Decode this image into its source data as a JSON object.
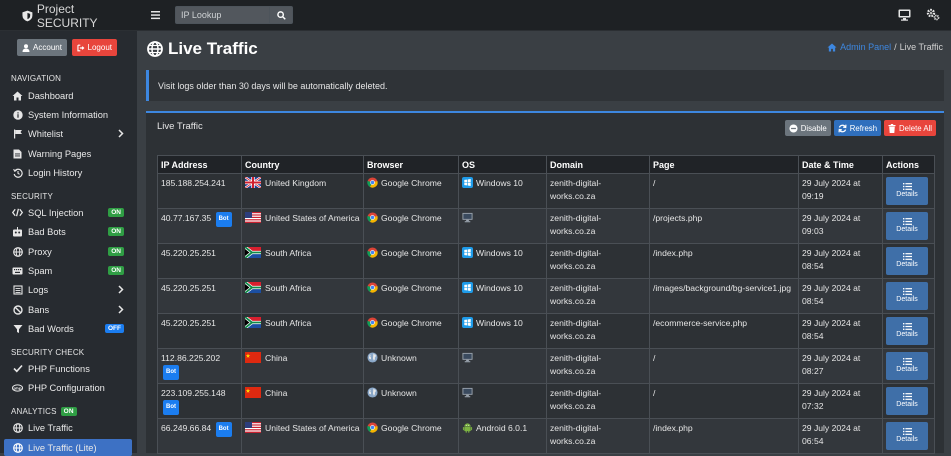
{
  "app": {
    "brand": "Project SECURITY"
  },
  "search": {
    "placeholder": "IP Lookup"
  },
  "account": {
    "account_label": "Account",
    "logout_label": "Logout"
  },
  "sidebar": {
    "navigation_heading": "NAVIGATION",
    "security_heading": "SECURITY",
    "security_check_heading": "SECURITY CHECK",
    "analytics_heading": "ANALYTICS",
    "analytics_badge": "ON",
    "items": {
      "dashboard": "Dashboard",
      "system_info": "System Information",
      "whitelist": "Whitelist",
      "warning_pages": "Warning Pages",
      "login_history": "Login History",
      "sql_injection": "SQL Injection",
      "bad_bots": "Bad Bots",
      "proxy": "Proxy",
      "spam": "Spam",
      "logs": "Logs",
      "bans": "Bans",
      "bad_words": "Bad Words",
      "php_functions": "PHP Functions",
      "php_configuration": "PHP Configuration",
      "live_traffic": "Live Traffic",
      "live_traffic_lite": "Live Traffic (Lite)"
    },
    "badges": {
      "sql_injection": "ON",
      "bad_bots": "ON",
      "proxy": "ON",
      "spam": "ON",
      "bad_words": "OFF"
    }
  },
  "page": {
    "title": "Live Traffic",
    "breadcrumb_home": "Admin Panel",
    "breadcrumb_sep": "/",
    "breadcrumb_current": "Live Traffic",
    "alert": "Visit logs older than 30 days will be automatically deleted."
  },
  "card": {
    "title": "Live Traffic",
    "disable_label": "Disable",
    "refresh_label": "Refresh",
    "delete_label": "Delete All"
  },
  "table": {
    "headers": [
      "IP Address",
      "Country",
      "Browser",
      "OS",
      "Domain",
      "Page",
      "Date & Time",
      "Actions"
    ],
    "details_label": "Details",
    "bot_label": "Bot",
    "rows": [
      {
        "ip": "185.188.254.241",
        "bot": false,
        "country": "United Kingdom",
        "flag": "uk",
        "browser": "Google Chrome",
        "browser_icon": "chrome",
        "os": "Windows 10",
        "os_icon": "windows",
        "domain": "zenith-digital-works.co.za",
        "page": "/",
        "datetime": "29 July 2024 at 09:19"
      },
      {
        "ip": "40.77.167.35",
        "bot": true,
        "country": "United States of America",
        "flag": "us",
        "browser": "Google Chrome",
        "browser_icon": "chrome",
        "os": "",
        "os_icon": "monitor",
        "domain": "zenith-digital-works.co.za",
        "page": "/projects.php",
        "datetime": "29 July 2024 at 09:03"
      },
      {
        "ip": "45.220.25.251",
        "bot": false,
        "country": "South Africa",
        "flag": "za",
        "browser": "Google Chrome",
        "browser_icon": "chrome",
        "os": "Windows 10",
        "os_icon": "windows",
        "domain": "zenith-digital-works.co.za",
        "page": "/index.php",
        "datetime": "29 July 2024 at 08:54"
      },
      {
        "ip": "45.220.25.251",
        "bot": false,
        "country": "South Africa",
        "flag": "za",
        "browser": "Google Chrome",
        "browser_icon": "chrome",
        "os": "Windows 10",
        "os_icon": "windows",
        "domain": "zenith-digital-works.co.za",
        "page": "/images/background/bg-service1.jpg",
        "datetime": "29 July 2024 at 08:54"
      },
      {
        "ip": "45.220.25.251",
        "bot": false,
        "country": "South Africa",
        "flag": "za",
        "browser": "Google Chrome",
        "browser_icon": "chrome",
        "os": "Windows 10",
        "os_icon": "windows",
        "domain": "zenith-digital-works.co.za",
        "page": "/ecommerce-service.php",
        "datetime": "29 July 2024 at 08:54"
      },
      {
        "ip": "112.86.225.202",
        "bot": true,
        "country": "China",
        "flag": "cn",
        "browser": "Unknown",
        "browser_icon": "globe",
        "os": "",
        "os_icon": "monitor",
        "domain": "zenith-digital-works.co.za",
        "page": "/",
        "datetime": "29 July 2024 at 08:27"
      },
      {
        "ip": "223.109.255.148",
        "bot": true,
        "country": "China",
        "flag": "cn",
        "browser": "Unknown",
        "browser_icon": "globe",
        "os": "",
        "os_icon": "monitor",
        "domain": "zenith-digital-works.co.za",
        "page": "/",
        "datetime": "29 July 2024 at 07:32"
      },
      {
        "ip": "66.249.66.84",
        "bot": true,
        "country": "United States of America",
        "flag": "us",
        "browser": "Google Chrome",
        "browser_icon": "chrome",
        "os": "Android 6.0.1",
        "os_icon": "android",
        "domain": "zenith-digital-works.co.za",
        "page": "/index.php",
        "datetime": "29 July 2024 at 06:54"
      }
    ]
  }
}
